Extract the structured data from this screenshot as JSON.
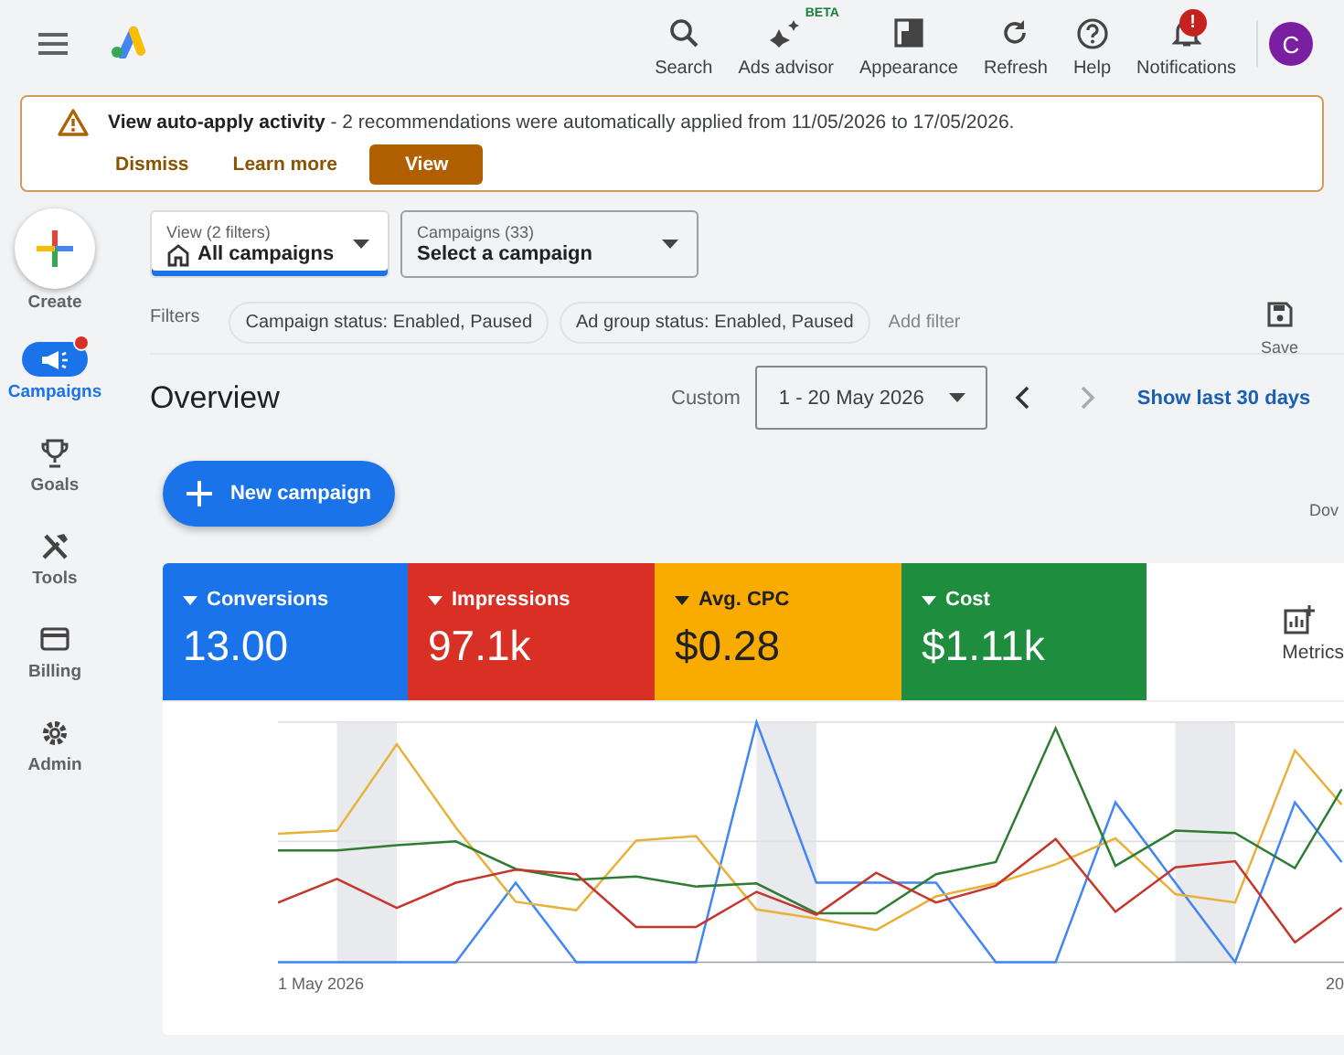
{
  "top_bar": {
    "actions": [
      {
        "kind": "search",
        "label": "Search"
      },
      {
        "kind": "advisor",
        "label": "Ads advisor",
        "tag": "BETA"
      },
      {
        "kind": "appearance",
        "label": "Appearance"
      },
      {
        "kind": "refresh",
        "label": "Refresh"
      },
      {
        "kind": "help",
        "label": "Help"
      },
      {
        "kind": "bell",
        "label": "Notifications",
        "badge": "!"
      }
    ],
    "avatar": "C"
  },
  "banner": {
    "title": "View auto-apply activity",
    "message": " - 2 recommendations were automatically applied from 11/05/2026 to 17/05/2026.",
    "buttons": [
      {
        "label": "Dismiss",
        "primary": false
      },
      {
        "label": "Learn more",
        "primary": false
      },
      {
        "label": "View",
        "primary": true
      }
    ]
  },
  "sidebar": {
    "create": "Create",
    "items": [
      {
        "kind": "campaigns",
        "label": "Campaigns",
        "selected": true,
        "dot": true
      },
      {
        "kind": "goals",
        "label": "Goals",
        "selected": false,
        "dot": false
      },
      {
        "kind": "tools",
        "label": "Tools",
        "selected": false,
        "dot": false
      },
      {
        "kind": "billing",
        "label": "Billing",
        "selected": false,
        "dot": false
      },
      {
        "kind": "admin",
        "label": "Admin",
        "selected": false,
        "dot": false
      }
    ]
  },
  "selectors": [
    {
      "caption": "View (2 filters)",
      "value": "All campaigns",
      "selected": true
    },
    {
      "caption": "Campaigns (33)",
      "value": "Select a campaign",
      "selected": false
    }
  ],
  "filters": {
    "label": "Filters",
    "chips": [
      "Campaign status: Enabled, Paused",
      "Ad group status: Enabled, Paused"
    ],
    "add": "Add filter",
    "save": "Save"
  },
  "overview": {
    "title": "Overview",
    "range_label": "Custom",
    "range": "1 - 20 May 2026",
    "next_disabled": true,
    "link": "Show last 30 days"
  },
  "new_campaign": "New campaign",
  "cut_label": "Dov",
  "metrics": [
    {
      "label": "Conversions",
      "value": "13.00",
      "color": "#1a73e8"
    },
    {
      "label": "Impressions",
      "value": "97.1k",
      "color": "#d93025"
    },
    {
      "label": "Avg. CPC",
      "value": "$0.28",
      "color": "#f9ab00"
    },
    {
      "label": "Cost",
      "value": "$1.11k",
      "color": "#1e8e3e"
    }
  ],
  "metrics_button": "Metrics",
  "chart": {
    "x_start": "1 May 2026",
    "x_end": "20"
  }
}
